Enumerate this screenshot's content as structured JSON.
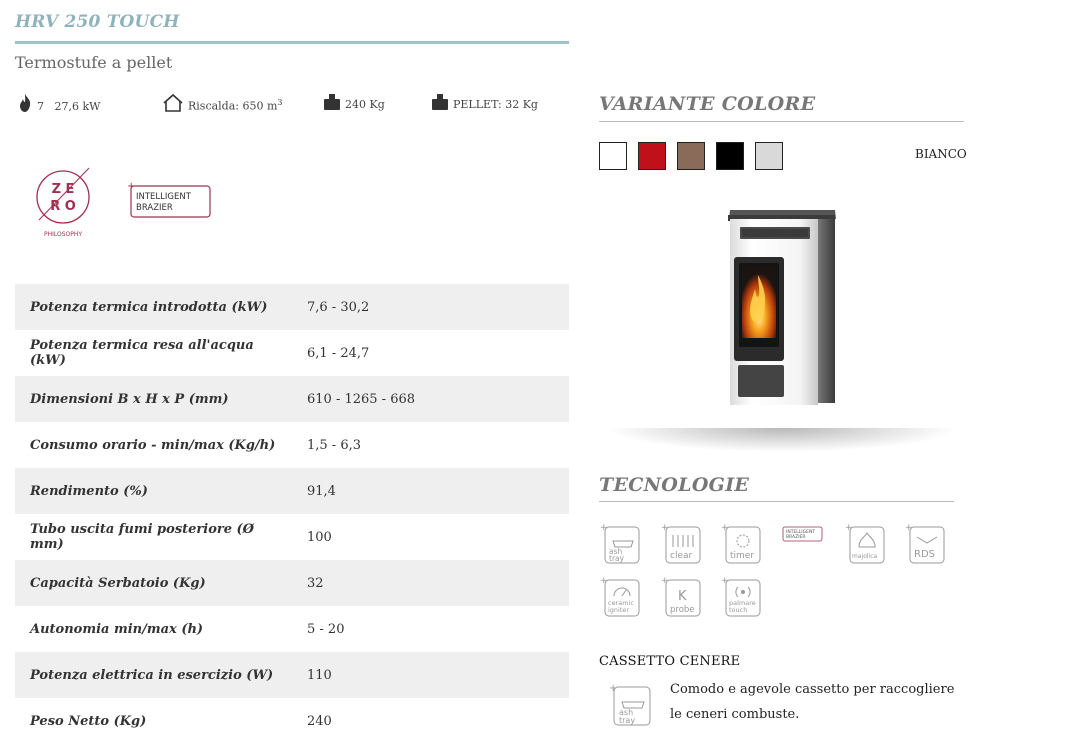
{
  "product": {
    "title": "HRV 250 TOUCH",
    "category": "Termostufe a pellet"
  },
  "quick_specs": [
    {
      "icon": "flame-icon",
      "label": "7   27,6 kW"
    },
    {
      "icon": "house-icon",
      "label": "Riscalda: 650 m",
      "sup": "3"
    },
    {
      "icon": "weight-icon",
      "label": "240 Kg"
    },
    {
      "icon": "weight-icon",
      "label": "PELLET: 32 Kg"
    }
  ],
  "badges": {
    "zero": {
      "line1": "Z E",
      "line2": "R O",
      "caption": "PHILOSOPHY"
    },
    "intelligent_brazier": {
      "line1": "INTELLIGENT",
      "line2": "BRAZIER",
      "plus": "+"
    }
  },
  "spec_table": [
    {
      "label": "Potenza termica introdotta (kW)",
      "value": "7,6 - 30,2"
    },
    {
      "label": "Potenza termica resa all'acqua (kW)",
      "value": "6,1 - 24,7"
    },
    {
      "label": "Dimensioni B x H x P (mm)",
      "value": "610 - 1265 - 668"
    },
    {
      "label": "Consumo orario - min/max (Kg/h)",
      "value": "1,5 - 6,3"
    },
    {
      "label": "Rendimento (%)",
      "value": "91,4"
    },
    {
      "label": "Tubo uscita fumi posteriore (Ø mm)",
      "value": "100"
    },
    {
      "label": "Capacità Serbatoio (Kg)",
      "value": "32"
    },
    {
      "label": "Autonomia min/max (h)",
      "value": "5 - 20"
    },
    {
      "label": "Potenza elettrica in esercizio (W)",
      "value": "110"
    },
    {
      "label": "Peso Netto (Kg)",
      "value": "240"
    }
  ],
  "color_variant": {
    "heading": "VARIANTE COLORE",
    "selected_label": "BIANCO",
    "swatches": [
      {
        "name": "bianco",
        "hex": "#ffffff"
      },
      {
        "name": "rosso",
        "hex": "#c0101a"
      },
      {
        "name": "bronzo",
        "hex": "#8a6a58"
      },
      {
        "name": "nero",
        "hex": "#000000"
      },
      {
        "name": "grigio",
        "hex": "#d9d9d9"
      }
    ]
  },
  "technologies": {
    "heading": "TECNOLOGIE",
    "items": [
      {
        "icon": "ash-tray-icon",
        "line1": "ash",
        "line2": "tray"
      },
      {
        "icon": "clear-icon",
        "line1": "",
        "line2": "clear"
      },
      {
        "icon": "timer-icon",
        "line1": "",
        "line2": "timer"
      },
      {
        "icon": "intelligent-brazier-icon",
        "line1": "INTELLIGENT",
        "line2": "BRAZIER"
      },
      {
        "icon": "majolica-icon",
        "line1": "",
        "line2": "majolica"
      },
      {
        "icon": "rds-icon",
        "line1": "",
        "line2": "RDS"
      },
      {
        "icon": "ceramic-igniter-icon",
        "line1": "ceramic",
        "line2": "igniter"
      },
      {
        "icon": "probe-icon",
        "line1": "K",
        "line2": "probe"
      },
      {
        "icon": "palmare-touch-icon",
        "line1": "palmare",
        "line2": "touch"
      }
    ]
  },
  "feature": {
    "title": "CASSETTO CENERE",
    "description": "Comodo e agevole cassetto per raccogliere le ceneri combuste.",
    "icon_line1": "ash",
    "icon_line2": "tray"
  },
  "colors": {
    "accent": "#9dc4c9",
    "title": "#8fb3bb",
    "row_alt": "#efefef",
    "badge": "#a03050"
  }
}
